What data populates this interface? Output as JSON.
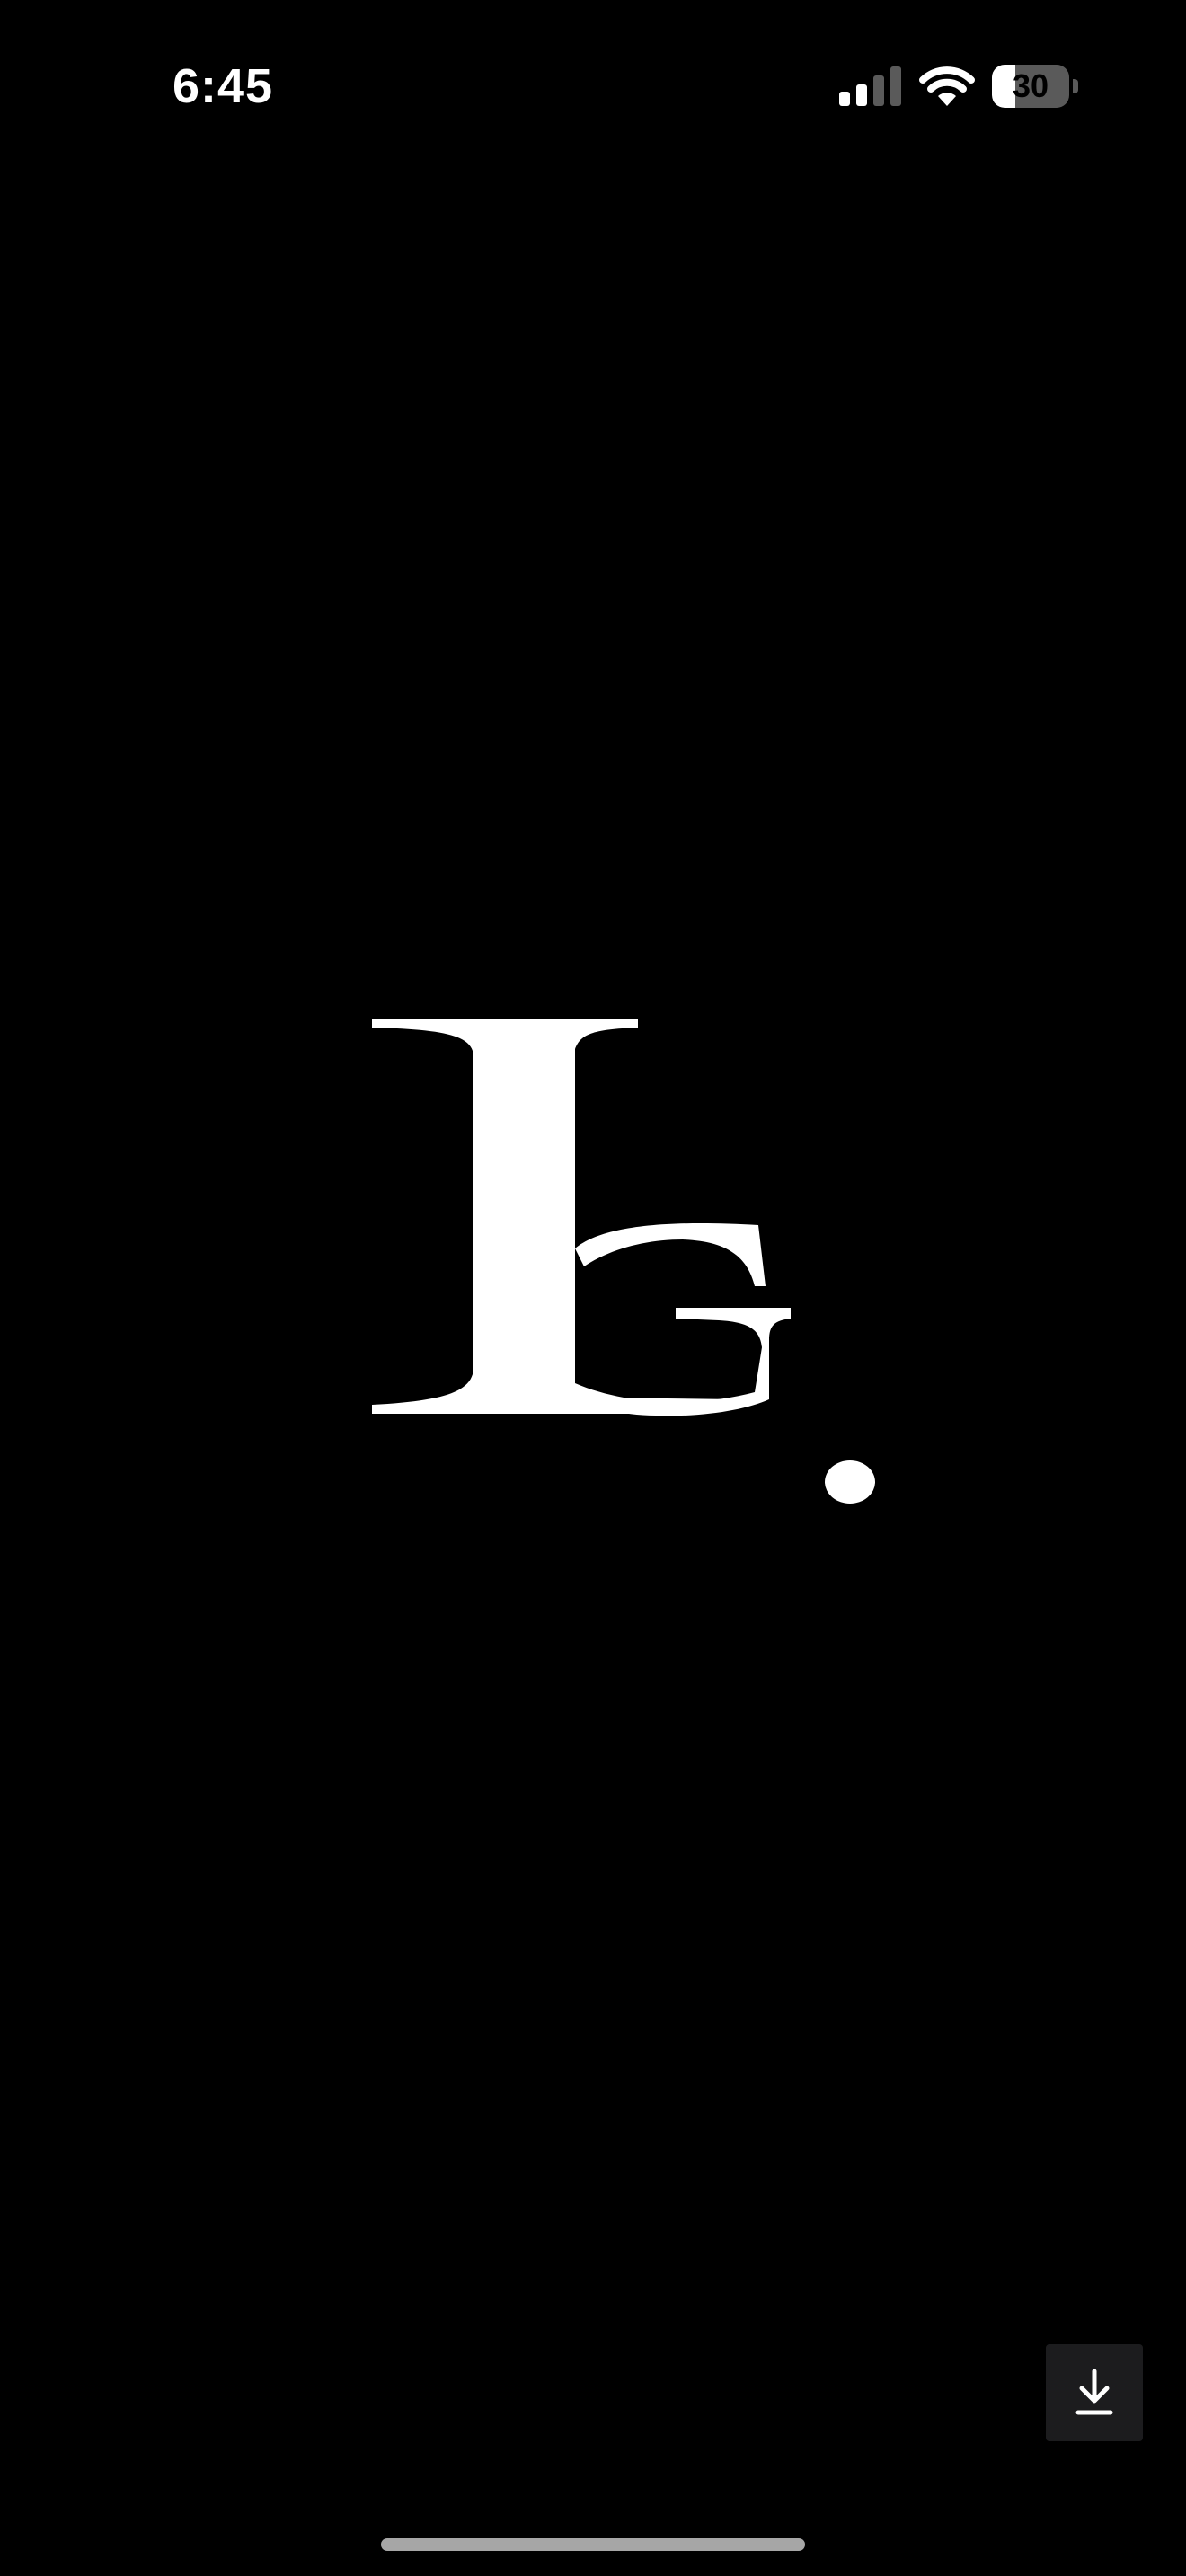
{
  "status_bar": {
    "time": "6:45",
    "battery_level": "30",
    "battery_fraction": 0.3,
    "icons": [
      "signal-icon",
      "wifi-icon",
      "battery-icon"
    ]
  },
  "logo": {
    "icon": "lg-monogram-logo",
    "text": "LG."
  },
  "actions": {
    "download_icon": "download-icon"
  },
  "colors": {
    "background": "#000000",
    "foreground": "#ffffff",
    "button_background": "#1c1c1e",
    "home_indicator": "#a6a6a6"
  }
}
